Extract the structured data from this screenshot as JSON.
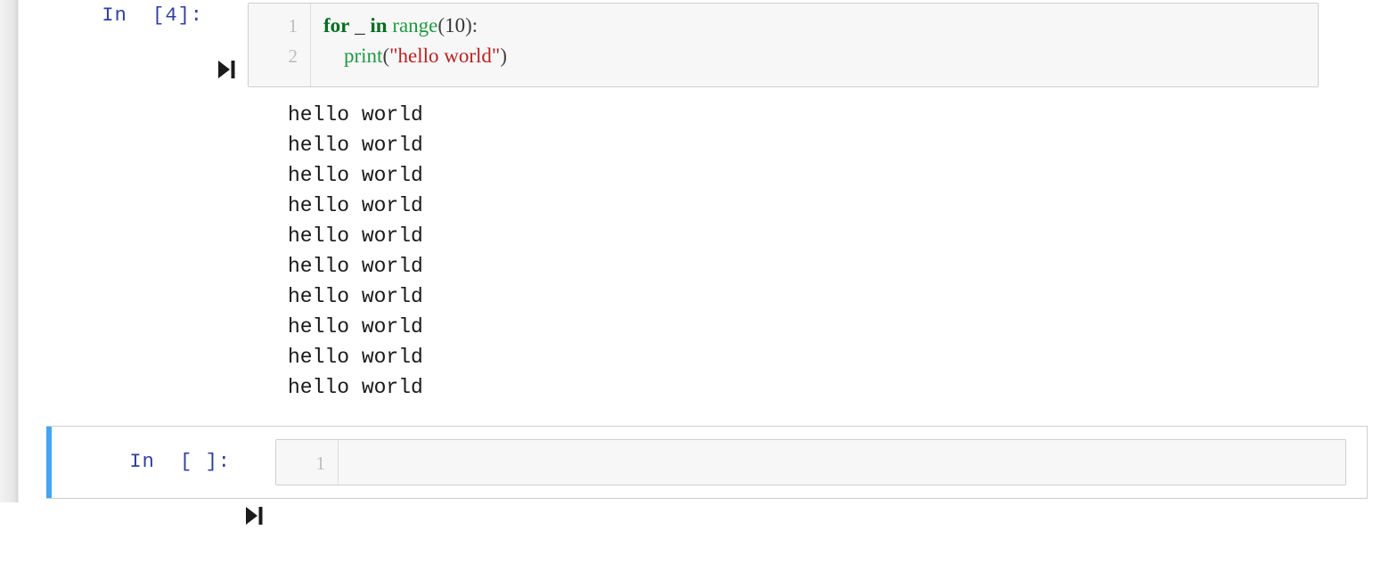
{
  "app": {
    "kind": "jupyter-notebook",
    "background": "#ffffff",
    "selection_bar_color": "#42a5f5",
    "prompt_color": "#303F9F",
    "cell_border_color": "#cfcfcf",
    "cell_background": "#f7f7f7"
  },
  "cells": [
    {
      "id": "cell-1",
      "prompt": "In  [4]:",
      "execution_count": "4",
      "run_icon": "run-cell-icon",
      "line_numbers": [
        "1",
        "2"
      ],
      "code_lines": [
        [
          {
            "t": "for",
            "c": "kw"
          },
          {
            "t": " ",
            "c": "plain"
          },
          {
            "t": "_",
            "c": "plain"
          },
          {
            "t": " ",
            "c": "plain"
          },
          {
            "t": "in",
            "c": "kw"
          },
          {
            "t": " ",
            "c": "plain"
          },
          {
            "t": "range",
            "c": "bi"
          },
          {
            "t": "(",
            "c": "pun"
          },
          {
            "t": "10",
            "c": "num"
          },
          {
            "t": ")",
            "c": "pun"
          },
          {
            "t": ":",
            "c": "pun"
          }
        ],
        [
          {
            "t": "    ",
            "c": "plain"
          },
          {
            "t": "print",
            "c": "bi"
          },
          {
            "t": "(",
            "c": "pun"
          },
          {
            "t": "\"hello world\"",
            "c": "str"
          },
          {
            "t": ")",
            "c": "pun"
          }
        ]
      ],
      "output_lines": [
        "hello world",
        "hello world",
        "hello world",
        "hello world",
        "hello world",
        "hello world",
        "hello world",
        "hello world",
        "hello world",
        "hello world"
      ]
    },
    {
      "id": "cell-2",
      "prompt": "In  [ ]:",
      "execution_count": "",
      "run_icon": "run-cell-icon",
      "line_numbers": [
        "1"
      ],
      "code_lines": [
        []
      ],
      "selected": true,
      "placeholder": ""
    }
  ]
}
